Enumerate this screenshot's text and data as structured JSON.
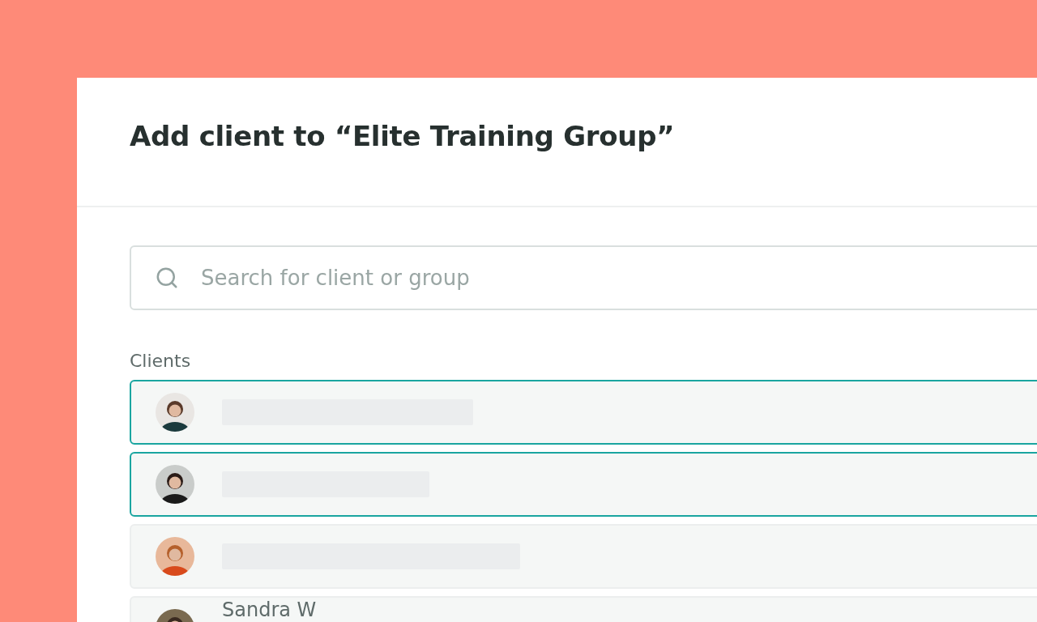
{
  "dialog": {
    "title": "Add client to “Elite Training Group”"
  },
  "search": {
    "placeholder": "Search for client or group"
  },
  "clients_label": "Clients",
  "clients": [
    {
      "kind": "loading",
      "selected": true
    },
    {
      "kind": "loading",
      "selected": true
    },
    {
      "kind": "loading",
      "selected": false
    },
    {
      "kind": "name",
      "name": "Sandra W",
      "selected": false
    }
  ]
}
